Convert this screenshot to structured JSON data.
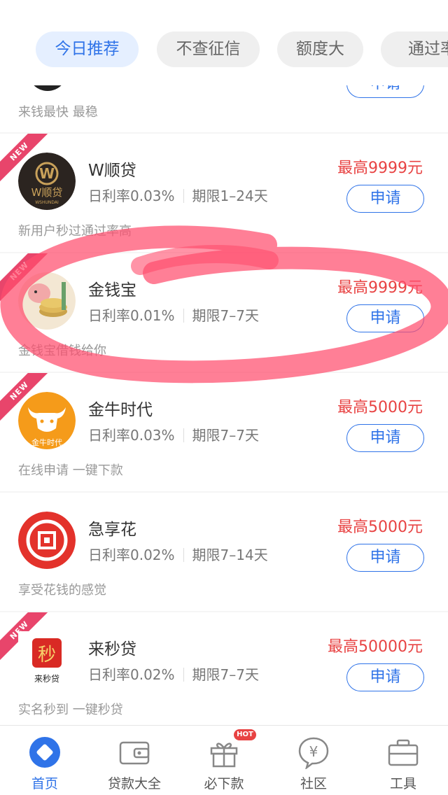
{
  "tabs": [
    {
      "label": "今日推荐",
      "active": true
    },
    {
      "label": "不查征信",
      "active": false
    },
    {
      "label": "额度大",
      "active": false
    },
    {
      "label": "通过率",
      "active": false
    }
  ],
  "partial_card": {
    "desc": "来钱最快  最稳",
    "apply_label": "申请"
  },
  "products": [
    {
      "badge": "NEW",
      "logo_text": "W顺贷",
      "logo_subtext": "WSHUNDAI",
      "name": "W顺贷",
      "rate": "日利率0.03%",
      "term": "期限1–24天",
      "amount": "最高9999元",
      "apply_label": "申请",
      "desc": "新用户秒过通过率高"
    },
    {
      "badge": "NEW",
      "name": "金钱宝",
      "rate": "日利率0.01%",
      "term": "期限7–7天",
      "amount": "最高9999元",
      "apply_label": "申请",
      "desc": "金钱宝借钱给你"
    },
    {
      "badge": "NEW",
      "logo_text": "金牛时代",
      "name": "金牛时代",
      "rate": "日利率0.03%",
      "term": "期限7–7天",
      "amount": "最高5000元",
      "apply_label": "申请",
      "desc": "在线申请   一键下款"
    },
    {
      "name": "急享花",
      "rate": "日利率0.02%",
      "term": "期限7–14天",
      "amount": "最高5000元",
      "apply_label": "申请",
      "desc": "享受花钱的感觉"
    },
    {
      "badge": "NEW",
      "logo_text": "秒",
      "logo_subtext": "来秒贷",
      "name": "来秒贷",
      "rate": "日利率0.02%",
      "term": "期限7–7天",
      "amount": "最高50000元",
      "apply_label": "申请",
      "desc": "实名秒到   一键秒贷"
    }
  ],
  "nav": [
    {
      "label": "首页",
      "icon": "home-diamond-icon",
      "active": true
    },
    {
      "label": "贷款大全",
      "icon": "wallet-icon",
      "active": false
    },
    {
      "label": "必下款",
      "icon": "gift-icon",
      "active": false,
      "badge": "HOT"
    },
    {
      "label": "社区",
      "icon": "yen-chat-icon",
      "active": false
    },
    {
      "label": "工具",
      "icon": "briefcase-icon",
      "active": false
    }
  ],
  "colors": {
    "accent": "#2f73e8",
    "amount": "#e84343",
    "badge": "#e8456b",
    "annotation": "#ff4d6d"
  }
}
